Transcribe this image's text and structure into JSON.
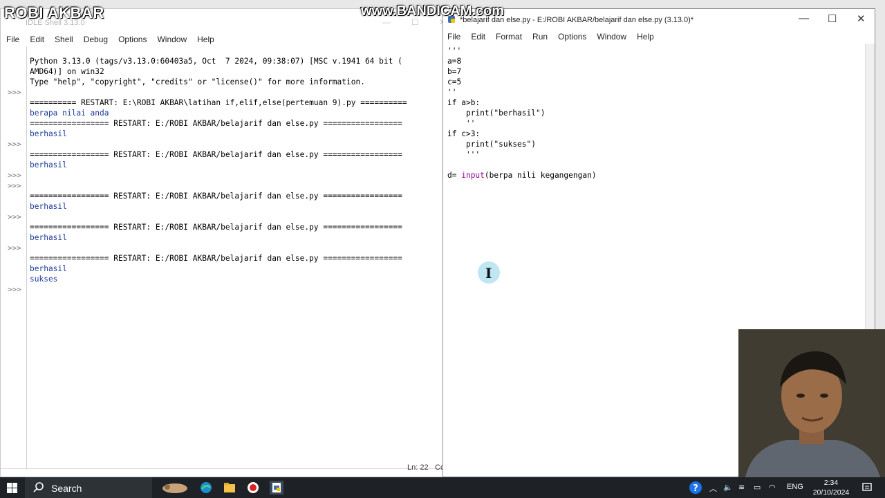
{
  "overlays": {
    "channel_name": "ROBI AKBAR",
    "recorder_watermark": "www.BANDICAM.com"
  },
  "shell": {
    "title": "IDLE Shell 3.13.0",
    "menu": [
      "File",
      "Edit",
      "Shell",
      "Debug",
      "Options",
      "Window",
      "Help"
    ],
    "prompts": [
      ">>>",
      ">>>",
      ">>>",
      ">>>",
      ">>>",
      ">>>",
      ">>>"
    ],
    "lines": [
      "Python 3.13.0 (tags/v3.13.0:60403a5, Oct  7 2024, 09:38:07) [MSC v.1941 64 bit (",
      "AMD64)] on win32",
      "Type \"help\", \"copyright\", \"credits\" or \"license()\" for more information.",
      "========== RESTART: E:\\ROBI AKBAR\\latihan if,elif,else(pertemuan 9).py ==========",
      "berapa nilai anda",
      "================= RESTART: E:/ROBI AKBAR/belajarif dan else.py =================",
      "berhasil",
      "================= RESTART: E:/ROBI AKBAR/belajarif dan else.py =================",
      "berhasil",
      "================= RESTART: E:/ROBI AKBAR/belajarif dan else.py =================",
      "berhasil",
      "================= RESTART: E:/ROBI AKBAR/belajarif dan else.py =================",
      "berhasil",
      "================= RESTART: E:/ROBI AKBAR/belajarif dan else.py =================",
      "berhasil",
      "sukses"
    ],
    "status_ln": "Ln: 22",
    "status_col": "Co"
  },
  "editor": {
    "title": "*belajarif dan else.py - E:/ROBI AKBAR/belajarif dan else.py (3.13.0)*",
    "menu": [
      "File",
      "Edit",
      "Format",
      "Run",
      "Options",
      "Window",
      "Help"
    ],
    "code": {
      "l1": "'''",
      "l2": "a=8",
      "l3": "b=7",
      "l4": "c=5",
      "l5": "''",
      "l6_kw": "if",
      "l6_rest": " a>b:",
      "l7_indent": "    ",
      "l7_bi": "print",
      "l7_rest": "(\"berhasil\")",
      "l8": "    ''",
      "l9_kw": "if",
      "l9_rest": " c>3:",
      "l10_indent": "    ",
      "l10_bi": "print",
      "l10_rest": "(\"sukses\")",
      "l11": "    '''",
      "l12_pre": "d= ",
      "l12_bi": "input",
      "l12_rest": "(berpa nili kegangengan)"
    }
  },
  "taskbar": {
    "search_label": "Search",
    "language": "ENG",
    "time": "2:34",
    "date": "20/10/2024"
  }
}
